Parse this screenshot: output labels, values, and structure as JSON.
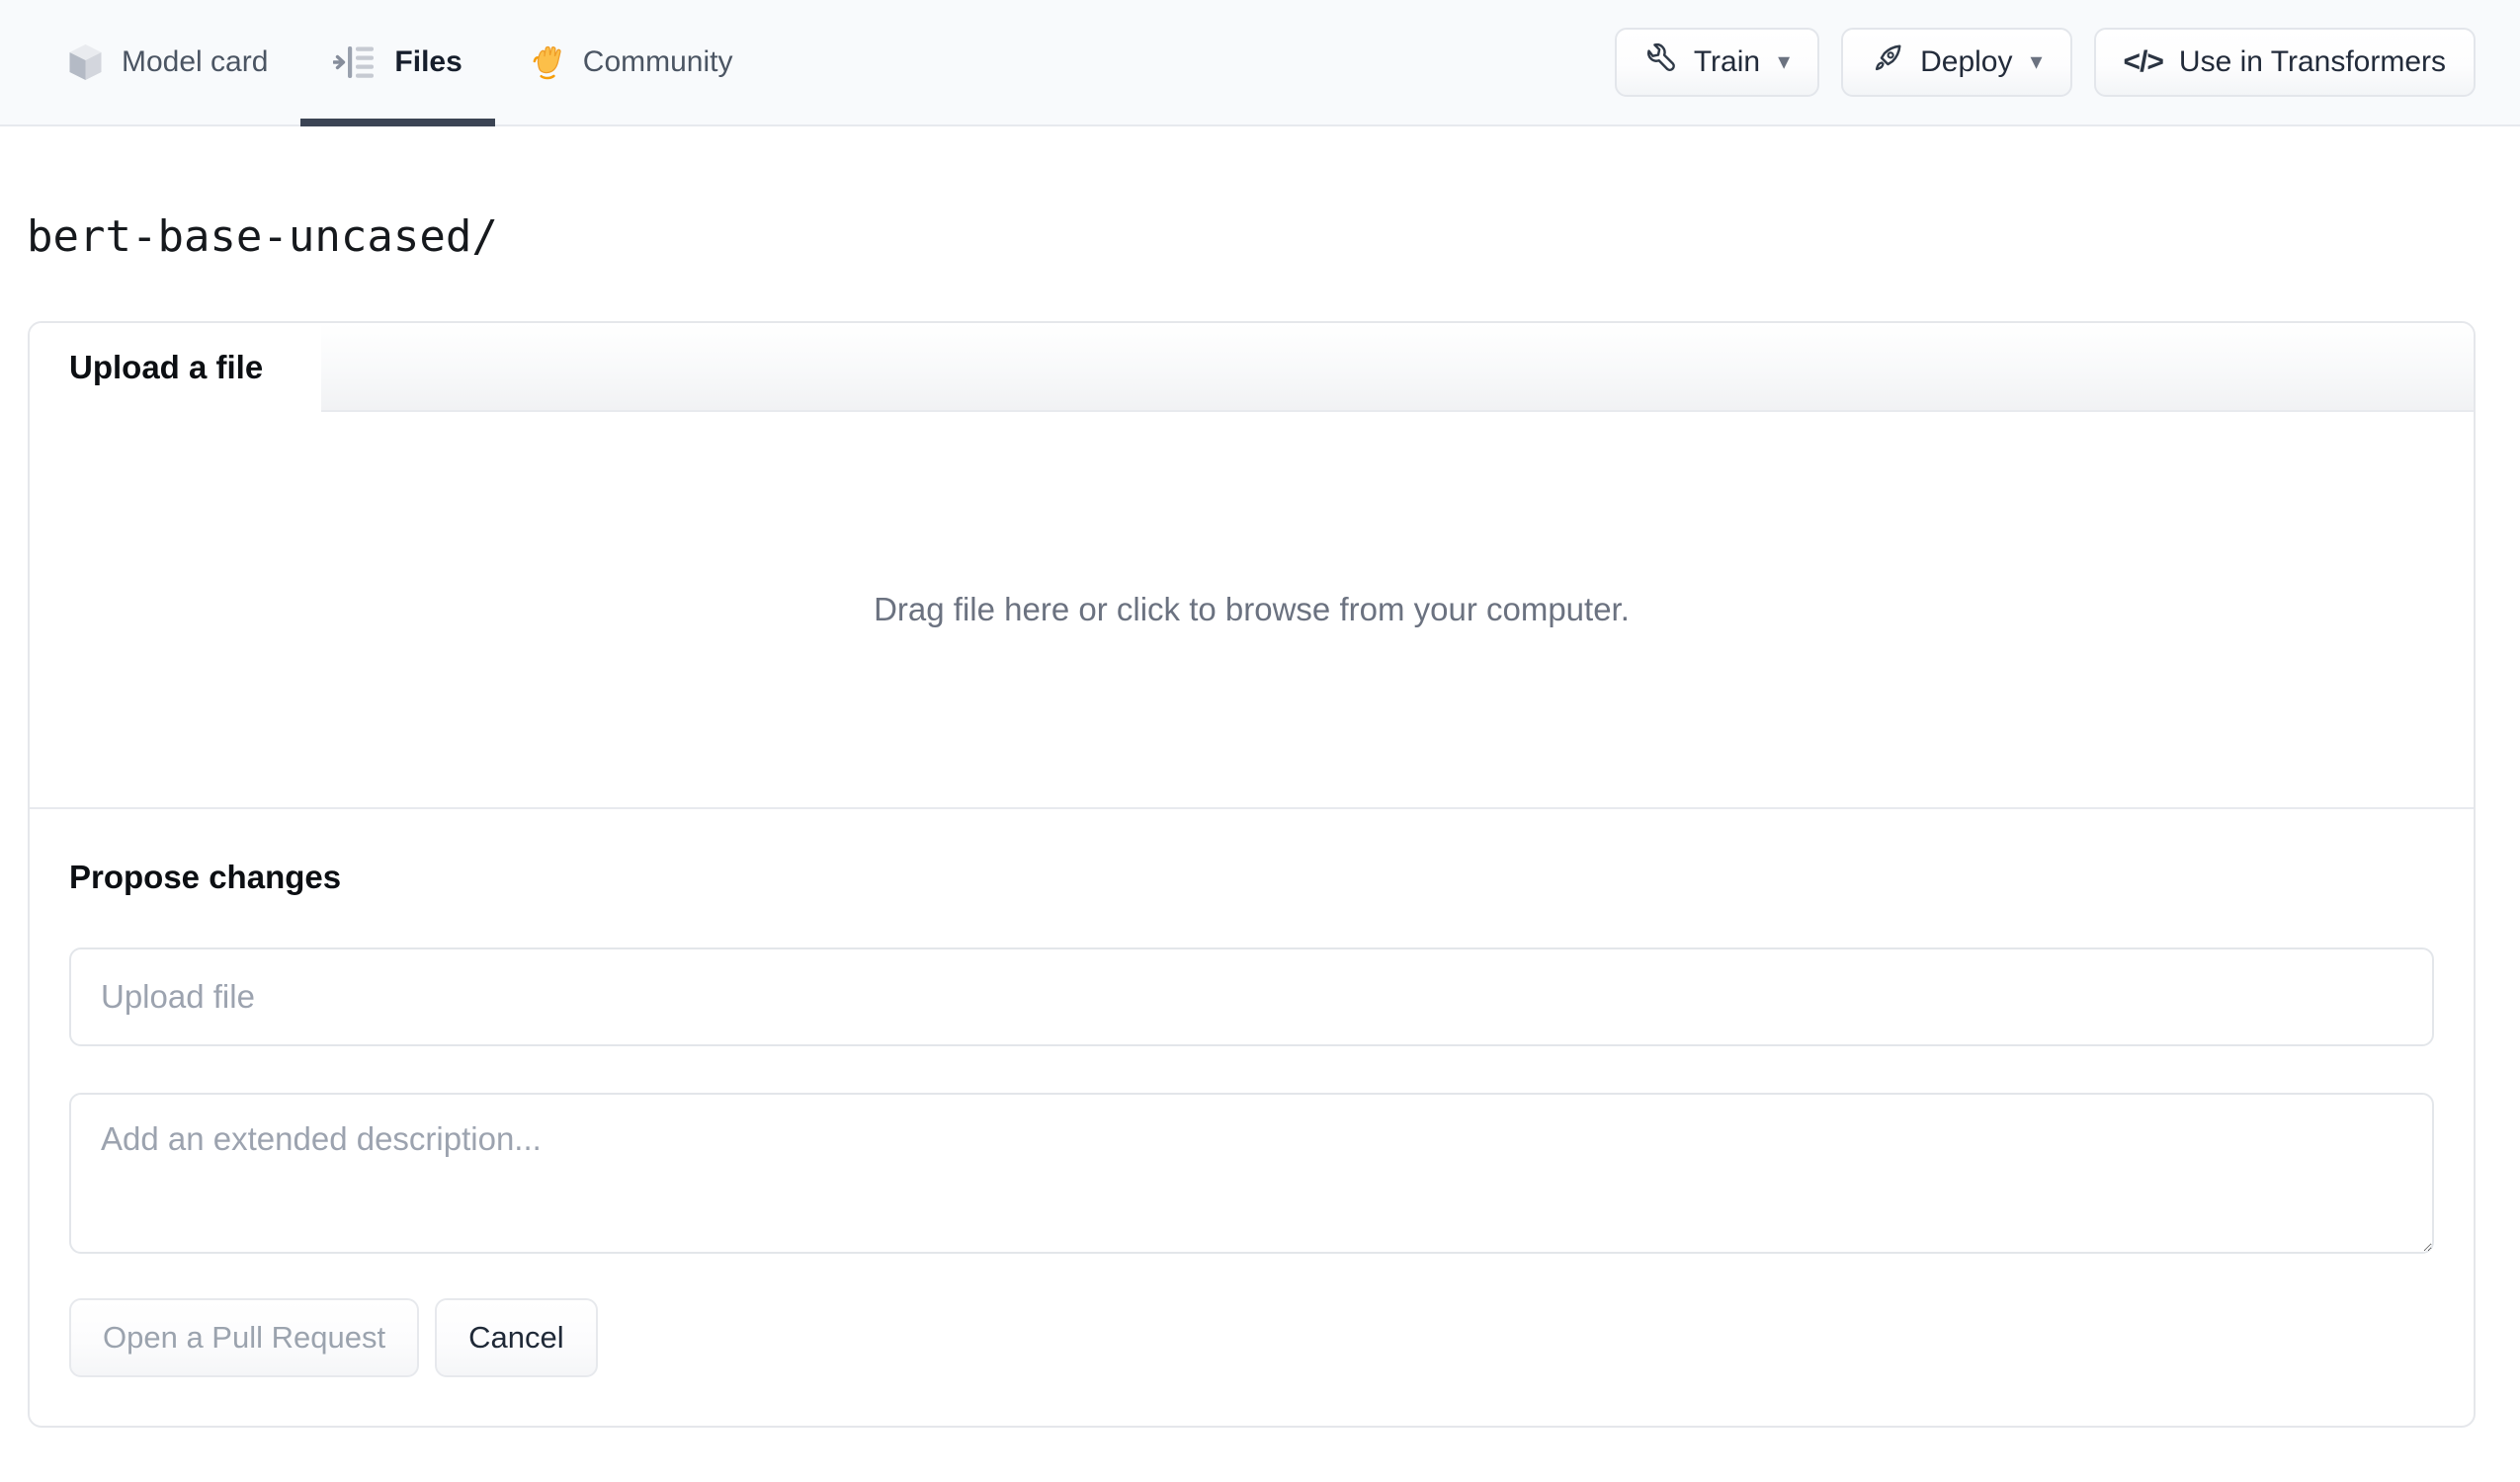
{
  "nav": {
    "tabs": {
      "model_card": {
        "label": "Model card"
      },
      "files": {
        "label": "Files",
        "active": true
      },
      "community": {
        "label": "Community",
        "emoji": "👋"
      }
    },
    "actions": {
      "train": {
        "label": "Train",
        "caret": "▾"
      },
      "deploy": {
        "label": "Deploy",
        "caret": "▾"
      },
      "use_in_transformers": {
        "label": "Use in Transformers",
        "icon_text": "</>"
      }
    }
  },
  "breadcrumb": {
    "path": "bert-base-uncased/"
  },
  "upload_panel": {
    "tab_label": "Upload a file",
    "dropzone_text": "Drag file here or click to browse from your computer.",
    "propose_heading": "Propose changes",
    "file_input_placeholder": "Upload file",
    "description_placeholder": "Add an extended description...",
    "open_pr_label": "Open a Pull Request",
    "cancel_label": "Cancel"
  },
  "colors": {
    "nav_bg": "#f8fafc",
    "active_underline": "#3b4454",
    "border": "#e5e7eb",
    "muted_text": "#6b7280",
    "placeholder": "#9ca3af"
  }
}
